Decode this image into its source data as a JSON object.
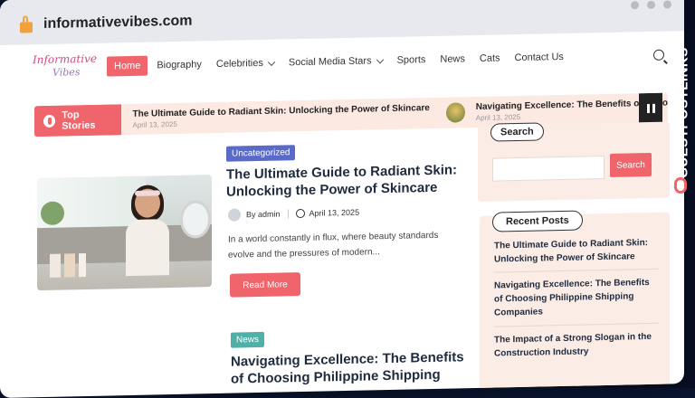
{
  "browser": {
    "url": "informativevibes.com"
  },
  "site": {
    "logo_line1": "Informative",
    "logo_line2": "Vibes",
    "nav": {
      "home": "Home",
      "biography": "Biography",
      "celebrities": "Celebrities",
      "social_media_stars": "Social Media Stars",
      "sports": "Sports",
      "news": "News",
      "cats": "Cats",
      "contact": "Contact Us"
    }
  },
  "ticker": {
    "label": "Top Stories",
    "items": [
      {
        "title": "The Ultimate Guide to Radiant Skin: Unlocking the Power of Skincare",
        "date": "April 13, 2025"
      },
      {
        "title": "Navigating Excellence: The Benefits of Choo",
        "date": "April 13, 2025"
      }
    ]
  },
  "posts": [
    {
      "category": "Uncategorized",
      "title": "The Ultimate Guide to Radiant Skin: Unlocking the Power of Skincare",
      "author": "By admin",
      "date": "April 13, 2025",
      "excerpt": "In a world constantly in flux, where beauty standards evolve and the pressures of modern...",
      "read_more": "Read More"
    },
    {
      "category": "News",
      "title": "Navigating Excellence: The Benefits of Choosing Philippine Shipping"
    }
  ],
  "sidebar": {
    "search_title": "Search",
    "search_button": "Search",
    "recent_title": "Recent Posts",
    "recent": [
      "The Ultimate Guide to Radiant Skin: Unlocking the Power of Skincare",
      "Navigating Excellence: The Benefits of Choosing Philippine Shipping Companies",
      "The Impact of a Strong Slogan in the Construction Industry"
    ]
  },
  "brand_badge": "GUESTPOSTLINKS",
  "colors": {
    "accent": "#f0656b",
    "badge_blue": "#5a6bc7",
    "badge_green": "#4fb0a8"
  }
}
